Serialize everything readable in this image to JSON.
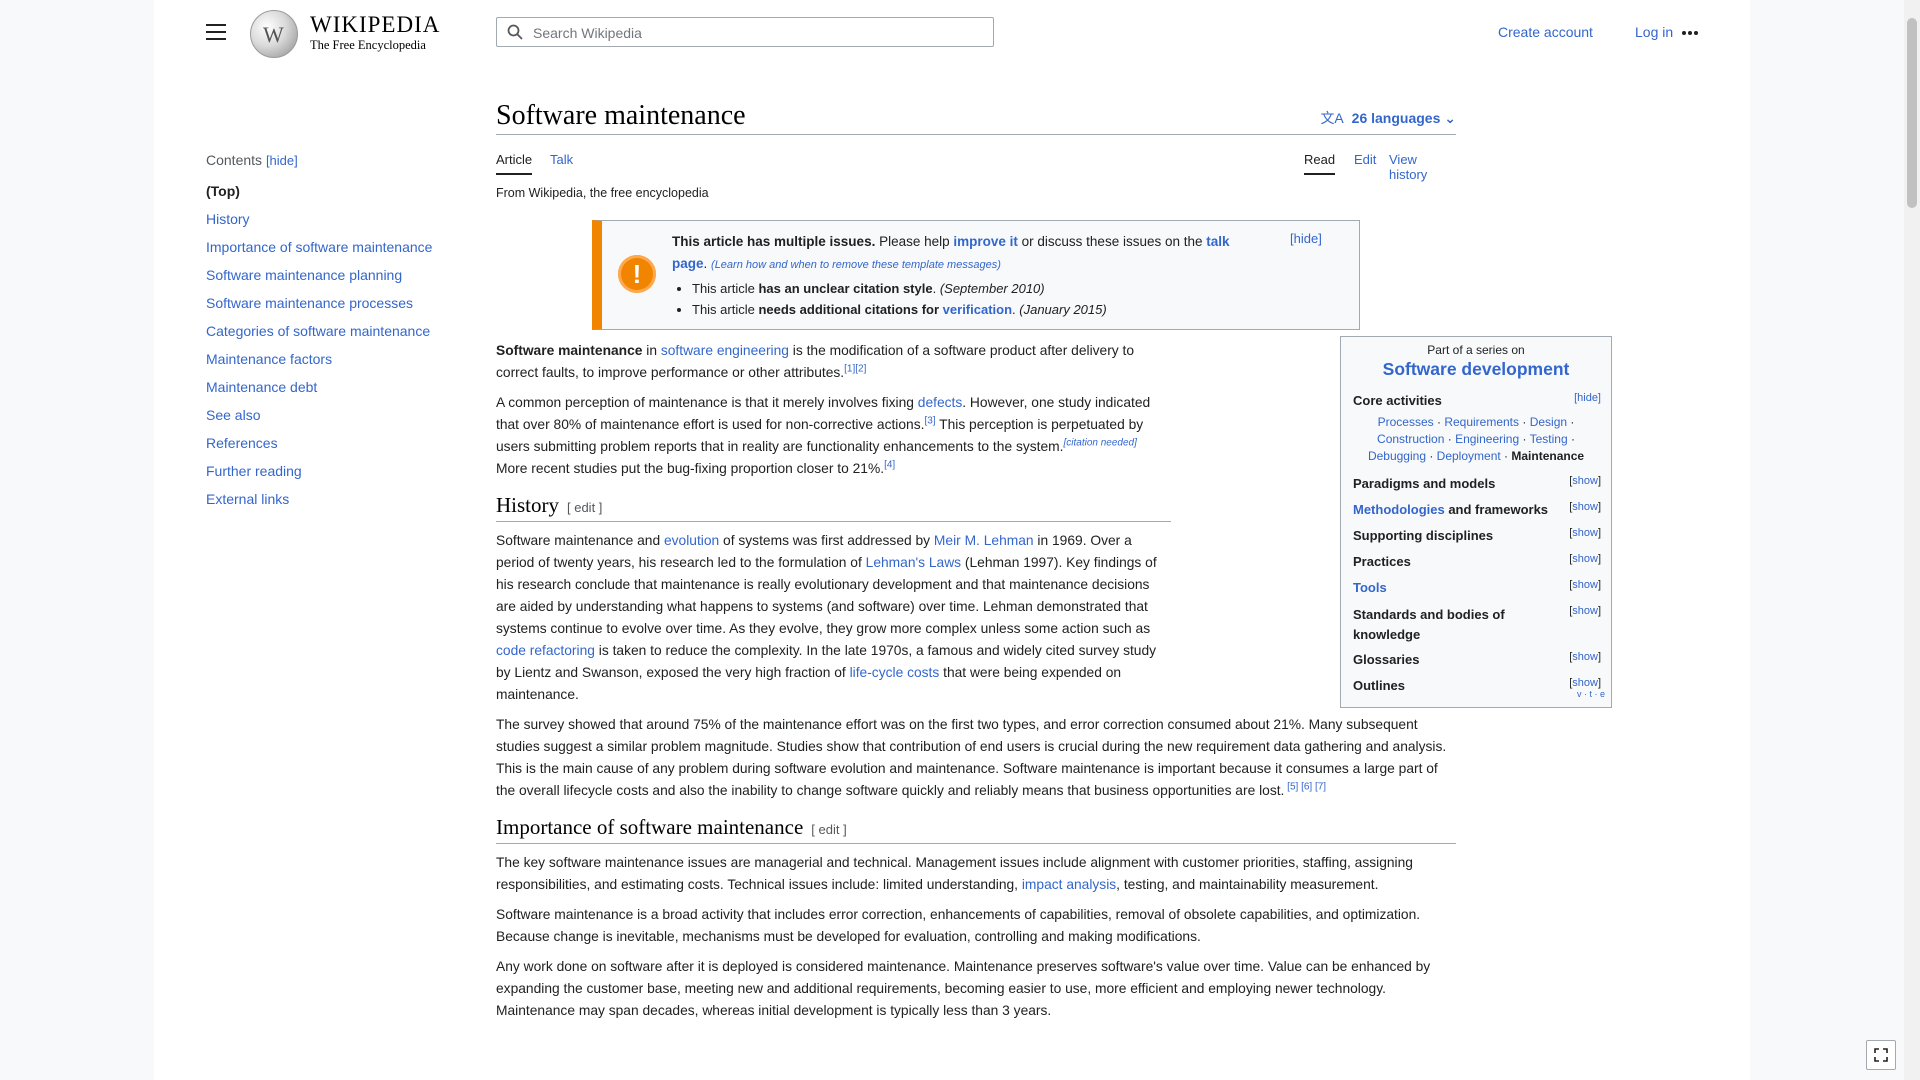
{
  "header": {
    "wordmark": "Wikipedia",
    "wordmark_display": "WIKIPEDIA",
    "tagline": "The Free Encyclopedia",
    "search_placeholder": "Search Wikipedia",
    "create_account": "Create account",
    "log_in": "Log in"
  },
  "toc": {
    "title": "Contents",
    "hide": "[hide]",
    "items": [
      "(Top)",
      "History",
      "Importance of software maintenance",
      "Software maintenance planning",
      "Software maintenance processes",
      "Categories of software maintenance",
      "Maintenance factors",
      "Maintenance debt",
      "See also",
      "References",
      "Further reading",
      "External links"
    ]
  },
  "article": {
    "title": "Software maintenance",
    "languages": "26 languages",
    "tabs": {
      "article": "Article",
      "talk": "Talk",
      "read": "Read",
      "edit": "Edit",
      "history": "View history"
    },
    "from": "From Wikipedia, the free encyclopedia"
  },
  "ambox": {
    "bold": "This article has multiple issues.",
    "t1": " Please help ",
    "improve": "improve it",
    "t2": " or discuss these issues on the ",
    "talk": "talk page",
    "t3": ". ",
    "learn": "(Learn how and when to remove these template messages)",
    "hide": "[hide]",
    "i1a": "This article ",
    "i1b": "has an unclear citation style",
    "i1c": ". ",
    "i1d": "(September 2010)",
    "i2a": "This article ",
    "i2b": "needs additional citations for ",
    "i2link": "verification",
    "i2c": ". ",
    "i2d": "(January 2015)"
  },
  "lead": {
    "p1a": "Software maintenance",
    "p1b": " in ",
    "p1link": "software engineering",
    "p1c": " is the modification of a software product after delivery to correct faults, to improve performance or other attributes.",
    "p1ref": "[1][2]",
    "p2a": "A common perception of maintenance is that it merely involves fixing ",
    "p2link": "defects",
    "p2b": ". However, one study indicated that over 80% of maintenance effort is used for non-corrective actions.",
    "p2ref": "[3]",
    "p2c": " This perception is perpetuated by users submitting problem reports that in reality are functionality enhancements to the system.",
    "p2cn": "[citation needed]",
    "p2d": " More recent studies put the bug-fixing proportion closer to 21%.",
    "p2ref2": "[4]"
  },
  "history": {
    "heading": "History",
    "edit": "[ edit ]",
    "p1a": "Software maintenance and ",
    "l1": "evolution",
    "p1b": " of systems was first addressed by ",
    "l2": "Meir M. Lehman",
    "p1c": " in 1969. Over a period of twenty years, his research led to the formulation of ",
    "l3": "Lehman's Laws",
    "p1d": " (Lehman 1997). Key findings of his research conclude that maintenance is really evolutionary development and that maintenance decisions are aided by understanding what happens to systems (and software) over time. Lehman demonstrated that systems continue to evolve over time. As they evolve, they grow more complex unless some action such as ",
    "l4": "code refactoring",
    "p1e": " is taken to reduce the complexity. In the late 1970s, a famous and widely cited survey study by Lientz and Swanson, exposed the very high fraction of ",
    "l5": "life-cycle costs",
    "p1f": " that were being expended on maintenance.",
    "p2": "The survey showed that around 75% of the maintenance effort was on the first two types, and error correction consumed about 21%. Many subsequent studies suggest a similar problem magnitude. Studies show that contribution of end users is crucial during the new requirement data gathering and analysis. This is the main cause of any problem during software evolution and maintenance. Software maintenance is important because it consumes a large part of the overall lifecycle costs and also the inability to change software quickly and reliably means that business opportunities are lost.",
    "p2ref": " [5] [6] [7]"
  },
  "importance": {
    "heading": "Importance of software maintenance",
    "edit": "[ edit ]",
    "p1a": "The key software maintenance issues are managerial and technical. Management issues include alignment with customer priorities, staffing, assigning responsibilities, and estimating costs. Technical issues include: limited understanding, ",
    "p1link": "impact analysis",
    "p1b": ", testing, and maintainability measurement.",
    "p2": "Software maintenance is a broad activity that includes error correction, enhancements of capabilities, removal of obsolete capabilities, and optimization. Because change is inevitable, mechanisms must be developed for evaluation, controlling and making modifications.",
    "p3": "Any work done on software after it is deployed is considered maintenance. Maintenance preserves software's value over time. Value can be enhanced by expanding the customer base, meeting new and additional requirements, becoming easier to use, more efficient and employing newer technology. Maintenance may span decades, whereas initial development is typically less than 3 years."
  },
  "sidebar": {
    "pre": "Part of a series on",
    "title": "Software development",
    "core": "Core activities",
    "hide": "[hide]",
    "core_links": [
      "Processes",
      "Requirements",
      "Design",
      "Construction",
      "Engineering",
      "Testing",
      "Debugging",
      "Deployment"
    ],
    "current": "Maintenance",
    "sep": " · ",
    "sections": [
      {
        "label": "Paradigms and models"
      },
      {
        "label_link": "Methodologies",
        "label": " and frameworks"
      },
      {
        "label": "Supporting disciplines"
      },
      {
        "label": "Practices"
      },
      {
        "label_link": "Tools",
        "label": ""
      },
      {
        "label": "Standards and bodies of knowledge"
      },
      {
        "label": "Glossaries"
      },
      {
        "label": "Outlines"
      }
    ],
    "show": "show",
    "vte": "v · t · e"
  },
  "colors": {
    "link": "#3366cc",
    "ambox_accent": "#f28500",
    "border": "#a2a9b1"
  }
}
